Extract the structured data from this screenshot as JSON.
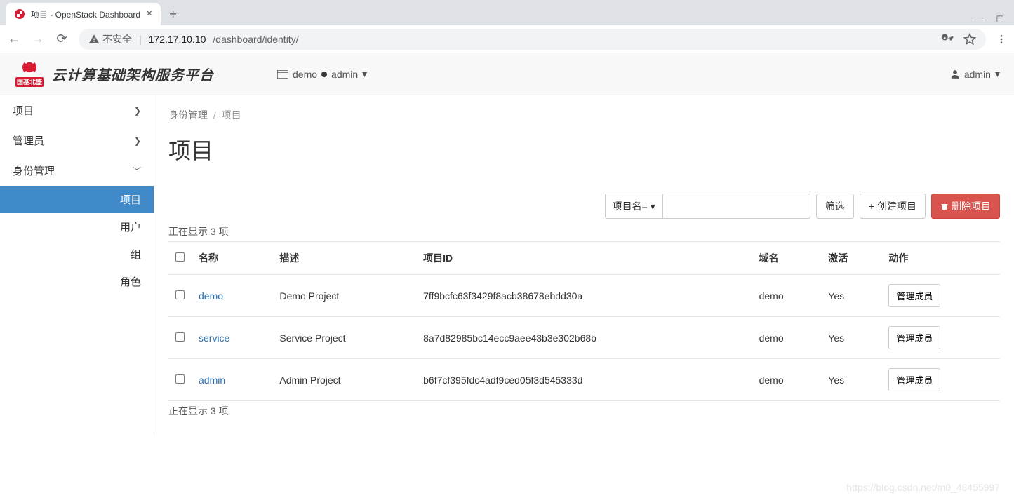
{
  "browser": {
    "tab_title": "项目 - OpenStack Dashboard",
    "url_insecure": "不安全",
    "url_host": "172.17.10.10",
    "url_path": "/dashboard/identity/"
  },
  "header": {
    "brand_text": "云计算基础架构服务平台",
    "brand_sub": "国基北盛",
    "project": "demo",
    "user_top": "admin",
    "user_right": "admin"
  },
  "sidebar": {
    "items": [
      {
        "label": "项目",
        "expanded": false
      },
      {
        "label": "管理员",
        "expanded": false
      },
      {
        "label": "身份管理",
        "expanded": true
      }
    ],
    "sub": [
      {
        "label": "项目",
        "active": true
      },
      {
        "label": "用户",
        "active": false
      },
      {
        "label": "组",
        "active": false
      },
      {
        "label": "角色",
        "active": false
      }
    ]
  },
  "breadcrumb": {
    "part1": "身份管理",
    "current": "项目"
  },
  "page": {
    "title": "项目"
  },
  "filters": {
    "select_label": "项目名=",
    "filter_btn": "筛选",
    "create_btn": "创建项目",
    "delete_btn": "删除项目"
  },
  "table": {
    "count_text": "正在显示 3 项",
    "columns": {
      "name": "名称",
      "desc": "描述",
      "id": "项目ID",
      "domain": "域名",
      "enabled": "激活",
      "actions": "动作"
    },
    "row_action_label": "管理成员",
    "rows": [
      {
        "name": "demo",
        "desc": "Demo Project",
        "id": "7ff9bcfc63f3429f8acb38678ebdd30a",
        "domain": "demo",
        "enabled": "Yes"
      },
      {
        "name": "service",
        "desc": "Service Project",
        "id": "8a7d82985bc14ecc9aee43b3e302b68b",
        "domain": "demo",
        "enabled": "Yes"
      },
      {
        "name": "admin",
        "desc": "Admin Project",
        "id": "b6f7cf395fdc4adf9ced05f3d545333d",
        "domain": "demo",
        "enabled": "Yes"
      }
    ]
  },
  "watermark": "https://blog.csdn.net/m0_48455997"
}
